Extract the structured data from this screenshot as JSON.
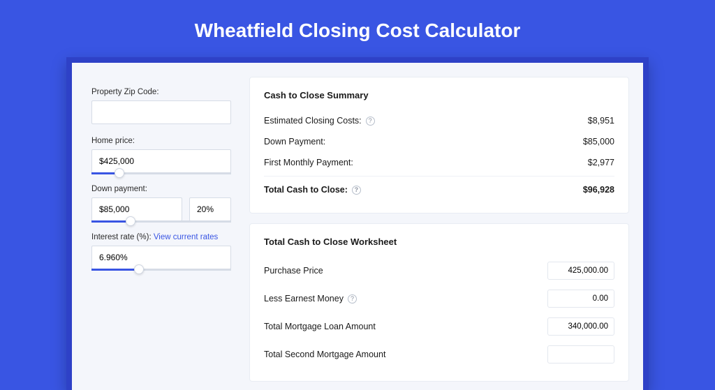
{
  "title": "Wheatfield Closing Cost Calculator",
  "left": {
    "zip_label": "Property Zip Code:",
    "zip_value": "",
    "home_price_label": "Home price:",
    "home_price_value": "$425,000",
    "home_price_slider_pct": 20,
    "down_label": "Down payment:",
    "down_value": "$85,000",
    "down_pct_value": "20%",
    "down_slider_pct": 28,
    "rate_label": "Interest rate (%):",
    "rate_link": "View current rates",
    "rate_value": "6.960%",
    "rate_slider_pct": 34
  },
  "summary": {
    "title": "Cash to Close Summary",
    "rows": [
      {
        "label": "Estimated Closing Costs:",
        "help": true,
        "value": "$8,951"
      },
      {
        "label": "Down Payment:",
        "help": false,
        "value": "$85,000"
      },
      {
        "label": "First Monthly Payment:",
        "help": false,
        "value": "$2,977"
      }
    ],
    "total": {
      "label": "Total Cash to Close:",
      "help": true,
      "value": "$96,928"
    }
  },
  "worksheet": {
    "title": "Total Cash to Close Worksheet",
    "rows": [
      {
        "label": "Purchase Price",
        "help": false,
        "value": "425,000.00"
      },
      {
        "label": "Less Earnest Money",
        "help": true,
        "value": "0.00"
      },
      {
        "label": "Total Mortgage Loan Amount",
        "help": false,
        "value": "340,000.00"
      },
      {
        "label": "Total Second Mortgage Amount",
        "help": false,
        "value": ""
      }
    ]
  }
}
